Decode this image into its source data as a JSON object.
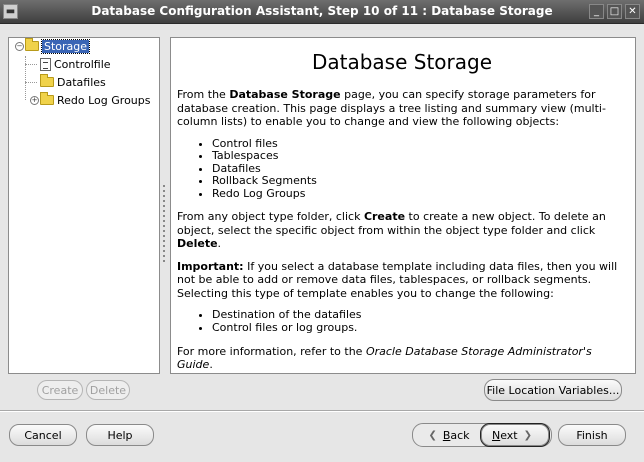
{
  "window": {
    "title": "Database Configuration Assistant, Step 10 of 11 : Database Storage"
  },
  "tree": {
    "items": [
      {
        "label": "Storage",
        "icon": "folder-icon",
        "expanded": true,
        "selected": true
      },
      {
        "label": "Controlfile",
        "icon": "file-icon"
      },
      {
        "label": "Datafiles",
        "icon": "folder-icon"
      },
      {
        "label": "Redo Log Groups",
        "icon": "folder-icon",
        "expanded": false
      }
    ]
  },
  "content": {
    "heading": "Database Storage",
    "intro_pre": "From the ",
    "intro_bold": "Database Storage",
    "intro_post": " page, you can specify storage parameters for database creation. This page displays a tree listing and summary view (multi-column lists) to enable you to change and view the following objects:",
    "objects": [
      "Control files",
      "Tablespaces",
      "Datafiles",
      "Rollback Segments",
      "Redo Log Groups"
    ],
    "create_pre": "From any object type folder, click ",
    "create_bold": "Create",
    "create_mid": " to create a new object. To delete an object, select the specific object from within the object type folder and click ",
    "delete_bold": "Delete",
    "create_end": ".",
    "important_bold": "Important:",
    "important_text": " If you select a database template including data files, then you will not be able to add or remove data files, tablespaces, or rollback segments. Selecting this type of template enables you to change the following:",
    "changeable": [
      "Destination of the datafiles",
      "Control files or log groups."
    ],
    "more_pre": "For more information, refer to the ",
    "more_italic": "Oracle Database Storage Administrator's Guide",
    "more_end": "."
  },
  "buttons": {
    "create": "Create",
    "delete": "Delete",
    "file_location": "File Location Variables...",
    "cancel": "Cancel",
    "help": "Help",
    "back_u": "B",
    "back_rest": "ack",
    "next_u": "N",
    "next_rest": "ext",
    "finish": "Finish"
  }
}
